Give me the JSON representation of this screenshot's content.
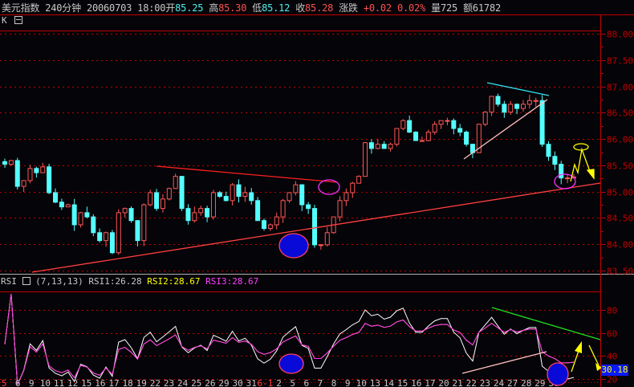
{
  "header": {
    "name": "美元指数",
    "period": "240分钟",
    "datetime": "20060703 18:00",
    "open_label": "开",
    "open": "85.25",
    "high_label": "高",
    "high": "85.30",
    "low_label": "低",
    "low": "85.12",
    "close_label": "收",
    "close": "85.28",
    "change_label": "涨跌",
    "change": "+0.02",
    "change_pct": "0.02%",
    "volume_label": "量",
    "volume": "725",
    "amount_label": "额",
    "amount": "61782"
  },
  "main_panel": {
    "label": "K",
    "collapse_icon": "minus-box-icon"
  },
  "rsi_panel": {
    "label": "RSI",
    "params": "(7,13,13)",
    "rsi1": "RSI1:26.28",
    "rsi2": "RSI2:28.67",
    "rsi3": "RSI3:28.67",
    "cursor_value": "30.18"
  },
  "colors": {
    "up": "#ff5858",
    "down": "#54ffff",
    "rsi1": "#ffffff",
    "rsi2": "#ffff00",
    "rsi3": "#ff30ff",
    "axis": "#c00000"
  },
  "chart_data": [
    {
      "type": "candlestick",
      "title": "",
      "y_ticks": [
        "88.00",
        "87.50",
        "87.00",
        "86.50",
        "86.00",
        "85.50",
        "85.00",
        "84.50",
        "84.00",
        "83.50"
      ],
      "ylim": [
        83.5,
        88.0
      ],
      "grid": true,
      "closes": [
        85.52,
        85.59,
        85.1,
        85.21,
        85.44,
        85.36,
        85.47,
        84.98,
        84.8,
        84.71,
        84.75,
        84.37,
        84.6,
        84.52,
        84.22,
        84.07,
        84.22,
        83.84,
        84.6,
        84.68,
        84.45,
        84.07,
        84.75,
        84.98,
        84.68,
        84.86,
        85.06,
        85.29,
        84.68,
        84.45,
        84.6,
        84.68,
        84.52,
        84.98,
        84.91,
        84.83,
        85.13,
        84.91,
        84.98,
        84.83,
        84.45,
        84.3,
        84.37,
        84.52,
        84.83,
        84.98,
        85.13,
        84.75,
        84.68,
        83.99,
        83.99,
        84.22,
        84.52,
        84.83,
        84.98,
        85.16,
        85.29,
        85.93,
        85.82,
        85.9,
        85.82,
        85.9,
        86.2,
        86.35,
        86.13,
        85.97,
        85.97,
        86.13,
        86.28,
        86.35,
        86.35,
        86.2,
        86.13,
        85.9,
        85.74,
        86.28,
        86.51,
        86.81,
        86.66,
        86.51,
        86.66,
        86.58,
        86.66,
        86.73,
        86.73,
        85.9,
        85.67,
        85.52,
        85.26,
        85.26,
        85.28
      ],
      "x_tick_labels": [
        "5",
        "6",
        "9",
        "10",
        "11",
        "12",
        "15",
        "16",
        "17",
        "18",
        "19",
        "22",
        "23",
        "24",
        "25",
        "26",
        "29",
        "30",
        "31",
        "6-1",
        "2",
        "5",
        "6",
        "7",
        "8",
        "9",
        "10",
        "13",
        "14",
        "15",
        "16",
        "17",
        "20",
        "21",
        "22",
        "23",
        "24",
        "27",
        "28",
        "29",
        "30"
      ],
      "month_start_labels": [
        "5",
        "6-1"
      ]
    },
    {
      "type": "line",
      "title": "RSI",
      "y_ticks": [
        "80",
        "60",
        "40",
        "20"
      ],
      "ylim": [
        15,
        95
      ],
      "series": [
        {
          "name": "RSI1",
          "period": 7
        },
        {
          "name": "RSI2",
          "period": 13
        },
        {
          "name": "RSI3",
          "period": 13
        }
      ]
    }
  ]
}
